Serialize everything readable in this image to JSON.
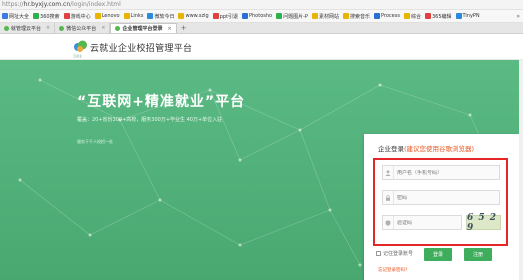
{
  "browser": {
    "url_prefix": "https://",
    "url_host": "hr.byxjy.com.cn",
    "url_path": "/login/index.html",
    "bookmarks": [
      {
        "label": "网址大全",
        "color": "#3c7be0"
      },
      {
        "label": "360搜索",
        "color": "#2bb24c"
      },
      {
        "label": "游戏中心",
        "color": "#e04040"
      },
      {
        "label": "Lenovo",
        "color": "#e8b400"
      },
      {
        "label": "Links",
        "color": "#e8b400"
      },
      {
        "label": "微软今日",
        "color": "#2a8ae0"
      },
      {
        "label": "www.szlg",
        "color": "#e8b400"
      },
      {
        "label": "ppt引退",
        "color": "#e04040"
      },
      {
        "label": "Photosho",
        "color": "#2a6fd4"
      },
      {
        "label": "问题图片-P",
        "color": "#2bb24c"
      },
      {
        "label": "素材网站",
        "color": "#e8b400"
      },
      {
        "label": "搜索音乐",
        "color": "#e8b400"
      },
      {
        "label": "Process",
        "color": "#2a6fd4"
      },
      {
        "label": "综合",
        "color": "#e8b400"
      },
      {
        "label": "365编辑",
        "color": "#e04040"
      },
      {
        "label": "TinyPN",
        "color": "#2a8ae0"
      }
    ],
    "bookmarks_more": "»",
    "tabs": [
      {
        "label": "就管理云平台",
        "active": false
      },
      {
        "label": "微信公众平台",
        "active": false
      },
      {
        "label": "企业管理平台登录",
        "active": true
      }
    ],
    "tab_close": "×",
    "tab_add": "+"
  },
  "header": {
    "logo_caption": "云就业",
    "site_title": "云就业企业校招管理平台"
  },
  "hero": {
    "slogan": "“互联网+精准就业”平台",
    "stats": "覆盖：20+省份300+高校，服务300万+毕业生  40万+单位入驻",
    "sub": "服务于千人校招一处"
  },
  "login": {
    "title": "企业登录",
    "title_note": "(建议您使用谷歌浏览器)",
    "username_placeholder": "用户名（手机号码）",
    "password_placeholder": "密码",
    "captcha_placeholder": "验证码",
    "captcha_text": "6 5 2 9",
    "remember_label": "记住登录账号",
    "login_button": "登录",
    "register_button": "注册",
    "forgot_link": "忘记登录密码?"
  },
  "colors": {
    "brand_green": "#49a870",
    "button_green": "#3fae5c",
    "highlight_red": "#e32626",
    "accent_orange": "#e8541c"
  }
}
